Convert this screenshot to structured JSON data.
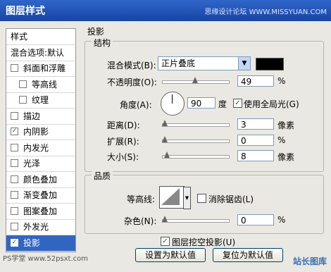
{
  "window": {
    "title": "图层样式",
    "watermark_top": "思缘设计论坛 WWW.MISSYUAN.COM"
  },
  "sidebar": {
    "items": [
      {
        "label": "样式",
        "checkbox": false,
        "checked": false
      },
      {
        "label": "混合选项:默认",
        "checkbox": false,
        "checked": false
      },
      {
        "label": "斜面和浮雕",
        "checkbox": true,
        "checked": false
      },
      {
        "label": "等高线",
        "checkbox": true,
        "checked": false,
        "sub": true
      },
      {
        "label": "纹理",
        "checkbox": true,
        "checked": false,
        "sub": true
      },
      {
        "label": "描边",
        "checkbox": true,
        "checked": false
      },
      {
        "label": "内阴影",
        "checkbox": true,
        "checked": true
      },
      {
        "label": "内发光",
        "checkbox": true,
        "checked": false
      },
      {
        "label": "光泽",
        "checkbox": true,
        "checked": false
      },
      {
        "label": "颜色叠加",
        "checkbox": true,
        "checked": false
      },
      {
        "label": "渐变叠加",
        "checkbox": true,
        "checked": false
      },
      {
        "label": "图案叠加",
        "checkbox": true,
        "checked": false
      },
      {
        "label": "外发光",
        "checkbox": true,
        "checked": false
      },
      {
        "label": "投影",
        "checkbox": true,
        "checked": true,
        "selected": true
      }
    ]
  },
  "panel": {
    "section_title": "投影",
    "structure": {
      "title": "结构",
      "blend_mode_label": "混合模式(B):",
      "blend_mode_value": "正片叠底",
      "blend_color": "#000000",
      "opacity_label": "不透明度(O):",
      "opacity_value": "49",
      "opacity_unit": "%",
      "angle_label": "角度(A):",
      "angle_value": "90",
      "angle_unit": "度",
      "global_light_label": "使用全局光(G)",
      "global_light_checked": true,
      "distance_label": "距离(D):",
      "distance_value": "3",
      "distance_unit": "像素",
      "spread_label": "扩展(R):",
      "spread_value": "0",
      "spread_unit": "%",
      "size_label": "大小(S):",
      "size_value": "8",
      "size_unit": "像素"
    },
    "quality": {
      "title": "品质",
      "contour_label": "等高线:",
      "antialias_label": "消除锯齿(L)",
      "antialias_checked": false,
      "noise_label": "杂色(N):",
      "noise_value": "0",
      "noise_unit": "%"
    },
    "knockout_label": "图层挖空投影(U)",
    "knockout_checked": true,
    "set_default_label": "设置为默认值",
    "reset_default_label": "复位为默认值"
  },
  "watermarks": {
    "bottom_left": "PS学堂 www.52psxt.com",
    "bottom_right": "站长图库"
  }
}
